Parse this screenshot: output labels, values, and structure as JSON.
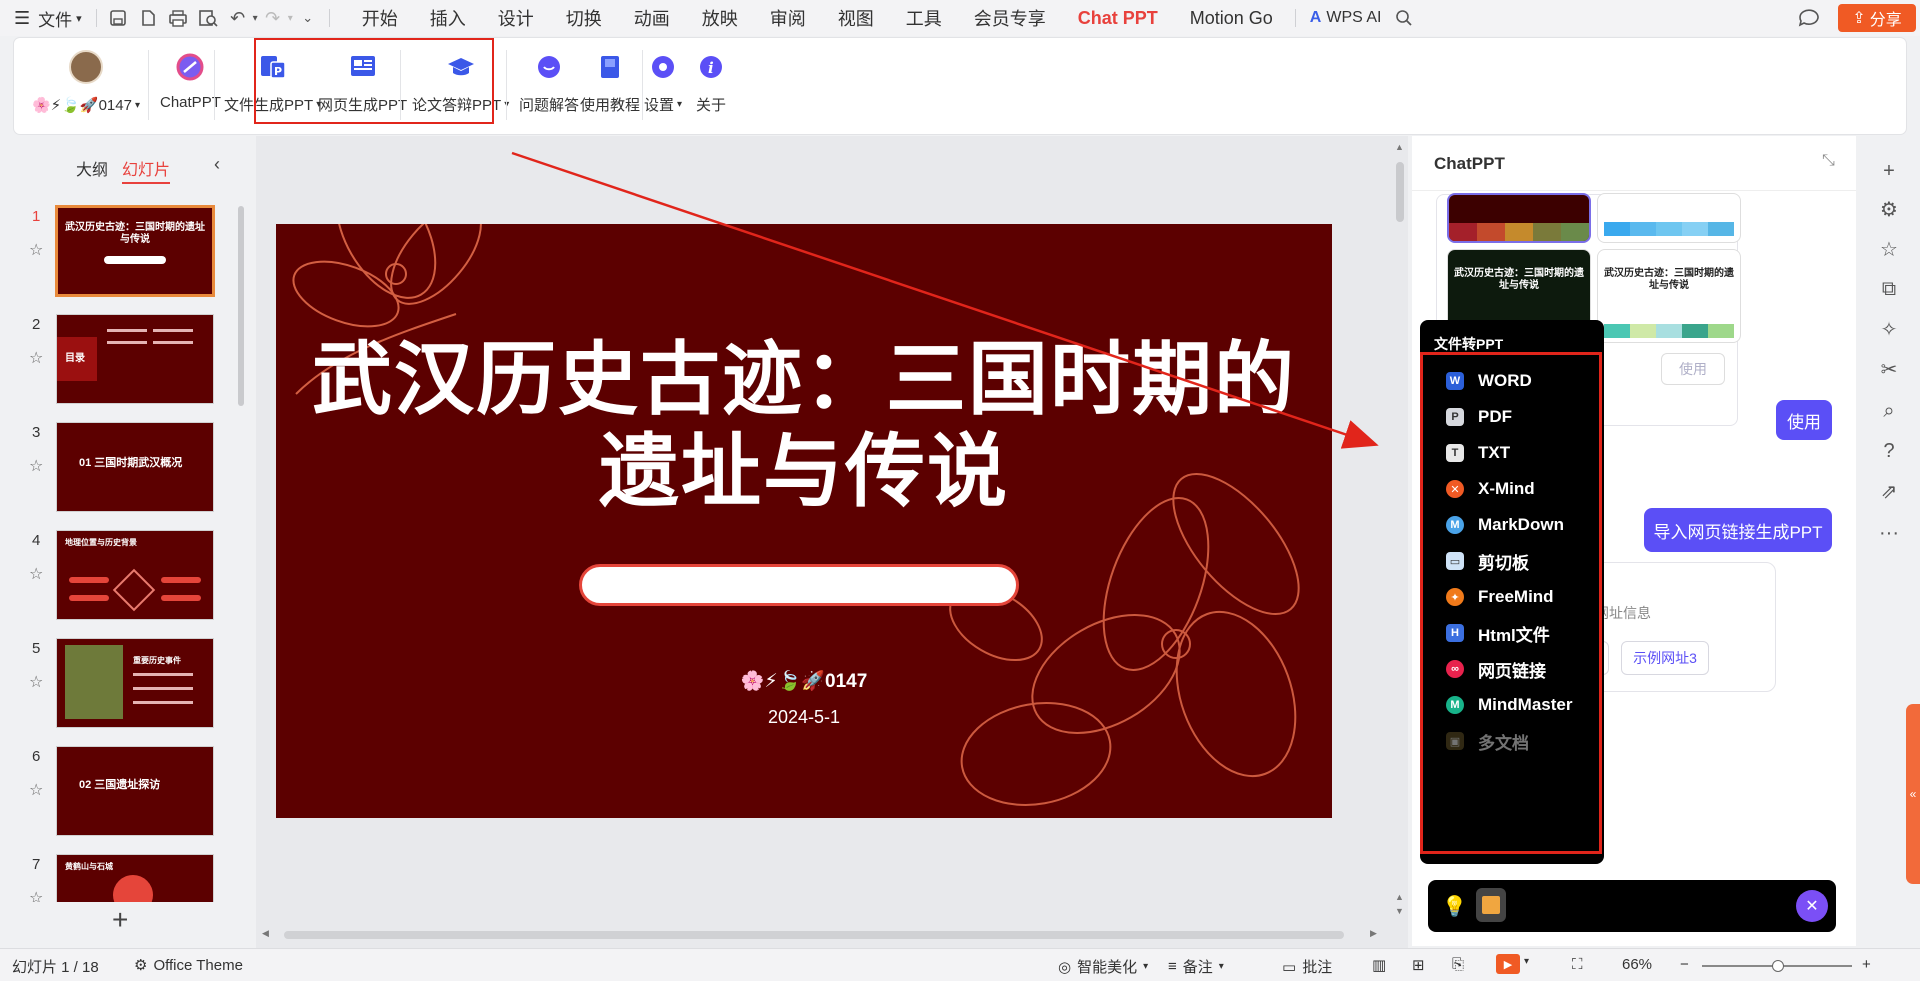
{
  "titlebar": {
    "file_menu": "文件",
    "tabs": [
      "开始",
      "插入",
      "设计",
      "切换",
      "动画",
      "放映",
      "审阅",
      "视图",
      "工具",
      "会员专享",
      "Chat PPT",
      "Motion Go"
    ],
    "active_tab": "Chat PPT",
    "wps_ai": "WPS AI",
    "share": "分享"
  },
  "ribbon": {
    "account_label": "🌸⚡🍃🚀0147",
    "chatppt": "ChatPPT",
    "file_gen": "文件生成PPT",
    "web_gen": "网页生成PPT",
    "thesis": "论文答辩PPT",
    "qa": "问题解答",
    "tutorial": "使用教程",
    "settings": "设置",
    "about": "关于"
  },
  "left_panel": {
    "tab_outline": "大纲",
    "tab_slides": "幻灯片",
    "slides": [
      {
        "num": "1",
        "title": "武汉历史古迹：三国时期的遗址与传说"
      },
      {
        "num": "2",
        "title": "目录"
      },
      {
        "num": "3",
        "title": "01  三国时期武汉概况"
      },
      {
        "num": "4",
        "title": "地理位置与历史背景"
      },
      {
        "num": "5",
        "title": "重要历史事件"
      },
      {
        "num": "6",
        "title": "02  三国遗址探访"
      },
      {
        "num": "7",
        "title": "黄鹤山与石城"
      }
    ]
  },
  "slide": {
    "title_line1": "武汉历史古迹：三国时期的",
    "title_line2": "遗址与传说",
    "author": "🌸⚡🍃🚀0147",
    "date": "2024-5-1"
  },
  "chat_panel": {
    "title": "ChatPPT",
    "template_a_title": "武汉历史古迹：三国时期的遗址与传说",
    "template_b_title": "武汉历史古迹：三国时期的遗址与传说",
    "use_disabled": "使用",
    "use_button": "使用",
    "import_web": "导入网页链接生成PPT",
    "partial_hint": "头的网址信息",
    "example2": "址2",
    "example3": "示例网址3"
  },
  "dropdown": {
    "header": "文件转PPT",
    "items": [
      {
        "label": "WORD",
        "color": "#2b5fd9",
        "glyph": "W"
      },
      {
        "label": "PDF",
        "color": "#d6d8de",
        "glyph": "P"
      },
      {
        "label": "TXT",
        "color": "#e8e8e8",
        "glyph": "T"
      },
      {
        "label": "X-Mind",
        "color": "#f05a24",
        "glyph": "✕"
      },
      {
        "label": "MarkDown",
        "color": "#4aa3e8",
        "glyph": "M"
      },
      {
        "label": "剪切板",
        "color": "#cfe3f7",
        "glyph": "▭"
      },
      {
        "label": "FreeMind",
        "color": "#f07a1a",
        "glyph": "✦"
      },
      {
        "label": "Html文件",
        "color": "#3b6fe0",
        "glyph": "H"
      },
      {
        "label": "网页链接",
        "color": "#e8224d",
        "glyph": "∞"
      },
      {
        "label": "MindMaster",
        "color": "#18b38a",
        "glyph": "M"
      },
      {
        "label": "多文档",
        "color": "#6b5a2a",
        "glyph": "▣"
      }
    ]
  },
  "statusbar": {
    "slide_count": "幻灯片 1 / 18",
    "theme": "Office Theme",
    "beautify": "智能美化",
    "notes": "备注",
    "comments": "批注",
    "zoom": "66%"
  },
  "colors": {
    "accent": "#e8413c",
    "slide_bg": "#5c0000",
    "purple": "#5b4ff6",
    "share": "#f05a24",
    "annotation": "#e1251b"
  }
}
